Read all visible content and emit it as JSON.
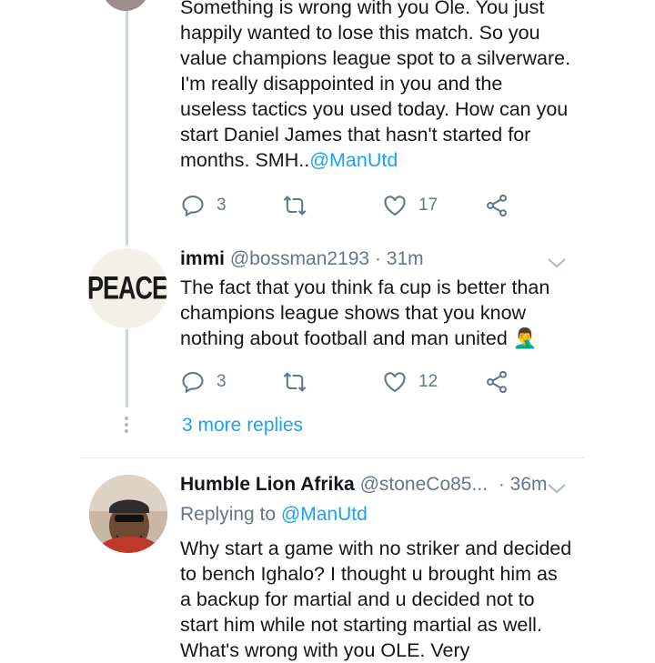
{
  "tweet1": {
    "text": "Something is wrong with you Ole. You just\nhappily wanted to lose this match. So you\nvalue champions league spot to a silverware.\nI'm really disappointed in you and the\nuseless tactics you used today. How can you\nstart Daniel James that hasn't started for\nmonths. SMH..",
    "mention": "@ManUtd",
    "actions": {
      "reply_count": "3",
      "retweet_count": "",
      "like_count": "17"
    }
  },
  "tweet2": {
    "name": "immi",
    "handle": "@bossman2193",
    "time": "· 31m",
    "avatar_text": "PEACE",
    "text": "The fact that you think fa cup is better than\nchampions league shows that you know\nnothing about football and man united 🤦‍♂",
    "actions": {
      "reply_count": "3",
      "retweet_count": "",
      "like_count": "12"
    }
  },
  "more_replies": "3 more replies",
  "tweet3": {
    "name": "Humble Lion Afrika",
    "handle": "@stoneCo85...",
    "time": "· 36m",
    "replying_prefix": "Replying to",
    "replying_to": "@ManUtd",
    "text": "Why start a game with no striker and decided\nto bench Ighalo? I thought u brought him as\na backup for martial and u decided not to\nstart him while not starting martial as well.\nWhat's wrong with you OLE. Very"
  },
  "colors": {
    "accent": "#1da1f2",
    "secondary_text": "#657786",
    "thread_line": "#ccd6dd"
  }
}
